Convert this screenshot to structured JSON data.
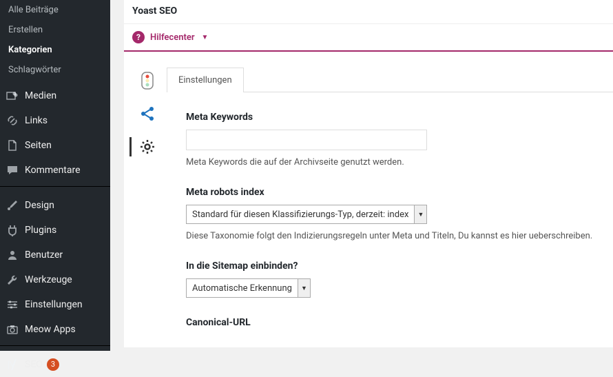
{
  "sidebar": {
    "sub_items": [
      {
        "label": "Alle Beiträge",
        "active": false
      },
      {
        "label": "Erstellen",
        "active": false
      },
      {
        "label": "Kategorien",
        "active": true
      },
      {
        "label": "Schlagwörter",
        "active": false
      }
    ],
    "items": {
      "medien": "Medien",
      "links": "Links",
      "seiten": "Seiten",
      "kommentare": "Kommentare",
      "design": "Design",
      "plugins": "Plugins",
      "benutzer": "Benutzer",
      "werkzeuge": "Werkzeuge",
      "einstellungen": "Einstellungen",
      "meow": "Meow Apps",
      "seo": "SEO"
    },
    "seo_badge": "3"
  },
  "metabox": {
    "title": "Yoast SEO",
    "helpcenter": "Hilfecenter",
    "tab_label": "Einstellungen"
  },
  "form": {
    "meta_keywords": {
      "label": "Meta Keywords",
      "value": "",
      "desc": "Meta Keywords die auf der Archivseite genutzt werden."
    },
    "meta_robots": {
      "label": "Meta robots index",
      "selected": "Standard für diesen Klassifizierungs-Typ, derzeit: index",
      "desc": "Diese Taxonomie folgt den Indizierungsregeln unter Meta und Titeln, Du kannst es hier ueberschreiben."
    },
    "sitemap": {
      "label": "In die Sitemap einbinden?",
      "selected": "Automatische Erkennung"
    },
    "canonical": {
      "label": "Canonical-URL"
    }
  }
}
